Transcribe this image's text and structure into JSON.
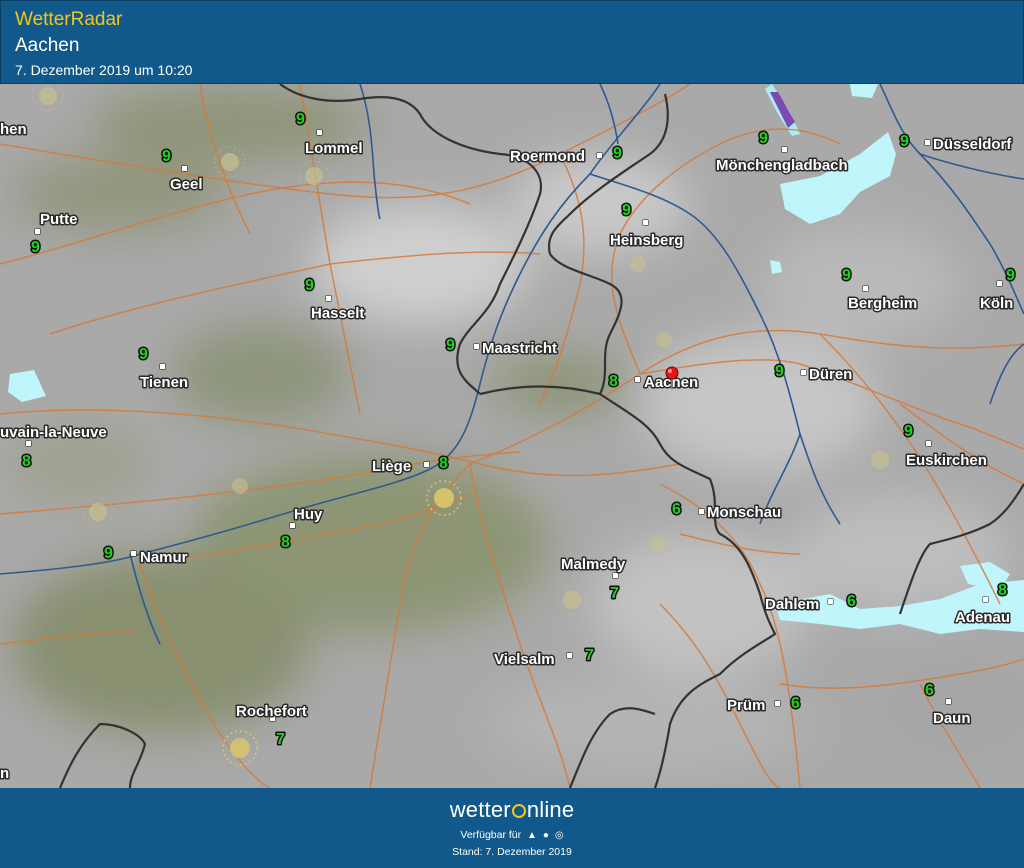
{
  "header": {
    "brand": "WetterRadar",
    "location": "Aachen",
    "timestamp": "7. Dezember 2019 um 10:20"
  },
  "map": {
    "marker_city": "Aachen",
    "cities": [
      {
        "name": "Aachen",
        "temp": "8"
      },
      {
        "name": "Maastricht",
        "temp": "9"
      },
      {
        "name": "Heinsberg",
        "temp": "9"
      },
      {
        "name": "Roermond",
        "temp": "9"
      },
      {
        "name": "Mönchengladbach",
        "temp": "9"
      },
      {
        "name": "Düsseldorf",
        "temp": "9"
      },
      {
        "name": "Köln",
        "temp": "9"
      },
      {
        "name": "Bergheim",
        "temp": "9"
      },
      {
        "name": "Düren",
        "temp": "9"
      },
      {
        "name": "Euskirchen",
        "temp": "9"
      },
      {
        "name": "Monschau",
        "temp": "6"
      },
      {
        "name": "Dahlem",
        "temp": "6"
      },
      {
        "name": "Adenau",
        "temp": "8"
      },
      {
        "name": "Daun",
        "temp": "6"
      },
      {
        "name": "Prüm",
        "temp": "6"
      },
      {
        "name": "Malmedy",
        "temp": "7"
      },
      {
        "name": "Vielsalm",
        "temp": "7"
      },
      {
        "name": "Liège",
        "temp": "8"
      },
      {
        "name": "Huy",
        "temp": "8"
      },
      {
        "name": "Namur",
        "temp": "9"
      },
      {
        "name": "Rochefort",
        "temp": "7"
      },
      {
        "name": "Hasselt",
        "temp": "9"
      },
      {
        "name": "Lommel",
        "temp": "9"
      },
      {
        "name": "Geel",
        "temp": "9"
      },
      {
        "name": "Putte",
        "temp": "9"
      },
      {
        "name": "Tienen",
        "temp": "9"
      },
      {
        "name": "uvain-la-Neuve",
        "temp": "8"
      }
    ],
    "edge_labels": [
      "hen",
      "n"
    ]
  },
  "footer": {
    "logo_pre": "wetter",
    "logo_post": "nline",
    "available_label": "Verfügbar für",
    "platforms": [
      "android-icon",
      "apple-icon",
      "web-icon"
    ],
    "stand": "Stand: 7. Dezember 2019"
  },
  "colors": {
    "header_bg": "#11598a",
    "brand_yellow": "#f3c61c",
    "temp_green": "#22d11f",
    "road": "#d57a3a",
    "river": "#2f5a8f",
    "border": "#333333",
    "precip": "#bff5fb"
  }
}
